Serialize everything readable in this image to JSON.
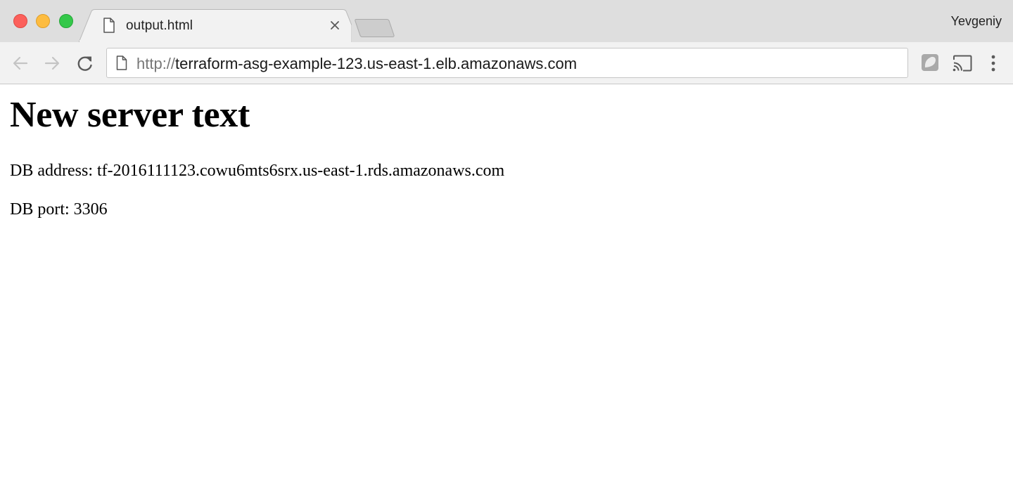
{
  "browser": {
    "tab": {
      "title": "output.html"
    },
    "profile_name": "Yevgeniy",
    "address_bar": {
      "scheme": "http://",
      "host": "terraform-asg-example-123.us-east-1.elb.amazonaws.com"
    },
    "icons": {
      "window_close": "red-traffic-light",
      "window_minimize": "yellow-traffic-light",
      "window_zoom": "green-traffic-light",
      "tab_page": "page-icon",
      "tab_close": "close-icon",
      "back": "back-arrow-icon",
      "forward": "forward-arrow-icon",
      "reload": "reload-icon",
      "omnibox_page": "page-icon",
      "extension": "extension-icon",
      "cast": "cast-icon",
      "menu": "kebab-menu-icon"
    },
    "colors": {
      "tabstrip_bg": "#dedede",
      "toolbar_bg": "#f2f2f2",
      "close_red": "#fc605b",
      "minimize_yellow": "#fdbc40",
      "zoom_green": "#34c84a"
    }
  },
  "page": {
    "heading": "New server text",
    "db_address": "DB address: tf-2016111123.cowu6mts6srx.us-east-1.rds.amazonaws.com",
    "db_port": "DB port: 3306"
  }
}
